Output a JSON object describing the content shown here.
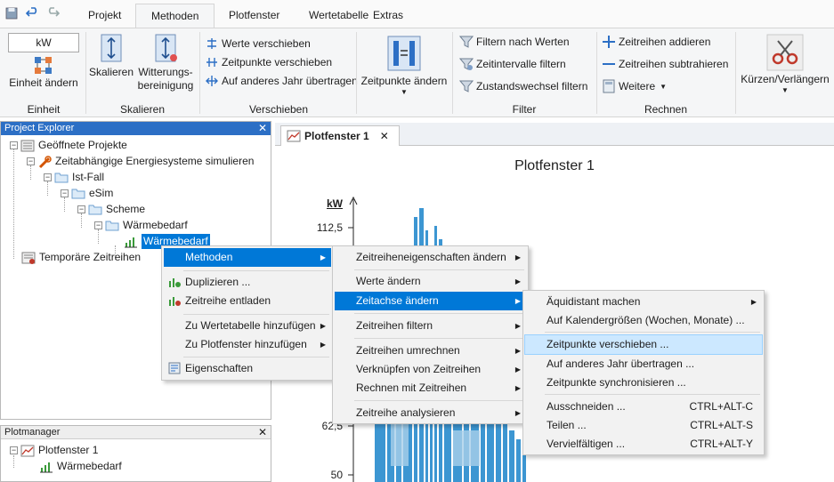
{
  "ribbon": {
    "tabs": [
      "Projekt",
      "Methoden",
      "Plotfenster",
      "Wertetabelle",
      "Extras"
    ],
    "active_tab": "Methoden",
    "einheit": {
      "unit_value": "kW",
      "button": "Einheit ändern",
      "group": "Einheit"
    },
    "skalieren": {
      "button1": "Skalieren",
      "button2_line1": "Witterungs-",
      "button2_line2": "bereinigung",
      "group": "Skalieren"
    },
    "verschieben": {
      "item1": "Werte verschieben",
      "item2": "Zeitpunkte verschieben",
      "item3": "Auf anderes Jahr übertragen",
      "group": "Verschieben"
    },
    "zeitpunkte": {
      "button": "Zeitpunkte ändern"
    },
    "filter": {
      "item1": "Filtern nach Werten",
      "item2": "Zeitintervalle filtern",
      "item3": "Zustandswechsel filtern",
      "group": "Filter"
    },
    "rechnen": {
      "item1": "Zeitreihen addieren",
      "item2": "Zeitreihen subtrahieren",
      "item3": "Weitere",
      "group": "Rechnen"
    },
    "kuerzen": {
      "button": "Kürzen/Verlängern"
    }
  },
  "project_explorer": {
    "title": "Project Explorer",
    "items": [
      "Geöffnete Projekte",
      "Zeitabhängige Energiesysteme simulieren",
      "Ist-Fall",
      "eSim",
      "Scheme",
      "Wärmebedarf",
      "Wärmebedarf",
      "Temporäre Zeitreihen"
    ]
  },
  "plotmanager": {
    "title": "Plotmanager",
    "items": [
      "Plotfenster 1",
      "Wärmebedarf"
    ]
  },
  "document": {
    "tab_label": "Plotfenster 1",
    "plot_title": "Plotfenster 1",
    "y_unit": "kW",
    "y_ticks": [
      "112,5",
      "62,5",
      "50"
    ]
  },
  "context_menu_1": {
    "items": [
      "Methoden",
      "Duplizieren ...",
      "Zeitreihe entladen",
      "Zu Wertetabelle hinzufügen",
      "Zu Plotfenster hinzufügen",
      "Eigenschaften"
    ]
  },
  "context_menu_2": {
    "items": [
      "Zeitreiheneigenschaften ändern",
      "Werte ändern",
      "Zeitachse ändern",
      "Zeitreihen filtern",
      "Zeitreihen umrechnen",
      "Verknüpfen von Zeitreihen",
      "Rechnen mit Zeitreihen",
      "Zeitreihe analysieren"
    ]
  },
  "context_menu_3": {
    "items": [
      "Äquidistant machen",
      "Auf Kalendergrößen (Wochen, Monate) ...",
      "Zeitpunkte verschieben ...",
      "Auf anderes Jahr übertragen ...",
      "Zeitpunkte synchronisieren ...",
      "Ausschneiden ...",
      "Teilen ...",
      "Vervielfältigen ..."
    ],
    "shortcuts": [
      "CTRL+ALT-C",
      "CTRL+ALT-S",
      "CTRL+ALT-Y"
    ]
  },
  "colors": {
    "accent": "#0078d7",
    "series": "#3c96d2",
    "panel_title": "#2c6fc5",
    "highlight": "#cce8ff"
  }
}
